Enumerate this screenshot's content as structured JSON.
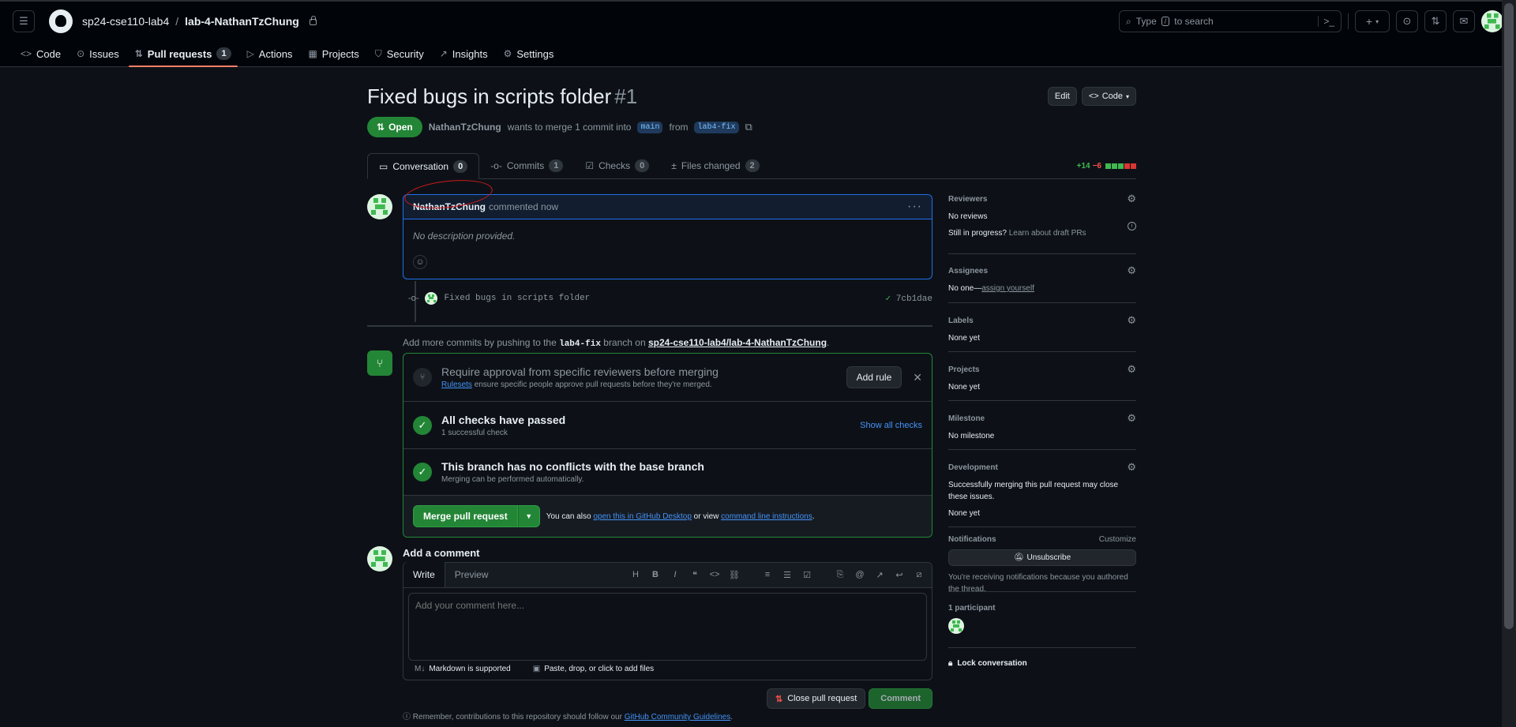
{
  "header": {
    "owner": "sp24-cse110-lab4",
    "repo": "lab-4-NathanTzChung",
    "search_prefix": "Type",
    "search_key": "/",
    "search_suffix": "to search"
  },
  "repo_nav": [
    {
      "icon": "<>",
      "label": "Code"
    },
    {
      "icon": "⊙",
      "label": "Issues"
    },
    {
      "icon": "⇅",
      "label": "Pull requests",
      "count": "1"
    },
    {
      "icon": "▷",
      "label": "Actions"
    },
    {
      "icon": "▦",
      "label": "Projects"
    },
    {
      "icon": "⛉",
      "label": "Security"
    },
    {
      "icon": "↗",
      "label": "Insights"
    },
    {
      "icon": "⚙",
      "label": "Settings"
    }
  ],
  "pr": {
    "title": "Fixed bugs in scripts folder",
    "number": "#1",
    "edit_label": "Edit",
    "code_label": "Code",
    "state": "Open",
    "author": "NathanTzChung",
    "merge_text_1": "wants to merge 1 commit into",
    "base_branch": "main",
    "merge_text_2": "from",
    "head_branch": "lab4-fix"
  },
  "tabs": [
    {
      "label": "Conversation",
      "count": "0",
      "icon": "▭"
    },
    {
      "label": "Commits",
      "count": "1",
      "icon": "-o-"
    },
    {
      "label": "Checks",
      "count": "0",
      "icon": "☑"
    },
    {
      "label": "Files changed",
      "count": "2",
      "icon": "±"
    }
  ],
  "diffstat": {
    "additions": "+14",
    "deletions": "−6"
  },
  "comment": {
    "author": "NathanTzChung",
    "when": "commented now",
    "body": "No description provided."
  },
  "timeline_commit": {
    "message": "Fixed bugs in scripts folder",
    "sha": "7cb1dae"
  },
  "push_note": {
    "prefix": "Add more commits by pushing to the",
    "branch": "lab4-fix",
    "mid": "branch on",
    "repo": "sp24-cse110-lab4/lab-4-NathanTzChung",
    "end": "."
  },
  "merge_box": {
    "rule_title": "Require approval from specific reviewers before merging",
    "rule_link": "Rulesets",
    "rule_sub": "ensure specific people approve pull requests before they're merged.",
    "add_rule": "Add rule",
    "checks_title": "All checks have passed",
    "checks_sub": "1 successful check",
    "show_checks": "Show all checks",
    "conflicts_title": "This branch has no conflicts with the base branch",
    "conflicts_sub": "Merging can be performed automatically.",
    "merge_button": "Merge pull request",
    "alt_prefix": "You can also",
    "alt_link1": "open this in GitHub Desktop",
    "alt_mid": "or view",
    "alt_link2": "command line instructions",
    "alt_end": "."
  },
  "add_comment": {
    "title": "Add a comment",
    "write_tab": "Write",
    "preview_tab": "Preview",
    "placeholder": "Add your comment here...",
    "markdown_note": "Markdown is supported",
    "files_note": "Paste, drop, or click to add files",
    "close_pr": "Close pull request",
    "comment_btn": "Comment",
    "footnote_prefix": "Remember, contributions to this repository should follow our",
    "footnote_link": "GitHub Community Guidelines",
    "footnote_end": "."
  },
  "sidebar": {
    "reviewers_label": "Reviewers",
    "reviewers_val": "No reviews",
    "draft_q": "Still in progress?",
    "draft_link": "Learn about draft PRs",
    "assignees_label": "Assignees",
    "assignees_val": "No one—",
    "assign_link": "assign yourself",
    "labels_label": "Labels",
    "labels_val": "None yet",
    "projects_label": "Projects",
    "projects_val": "None yet",
    "milestone_label": "Milestone",
    "milestone_val": "No milestone",
    "development_label": "Development",
    "development_text": "Successfully merging this pull request may close these issues.",
    "development_val": "None yet",
    "notifications_label": "Notifications",
    "customize": "Customize",
    "unsubscribe": "Unsubscribe",
    "notif_reason": "You're receiving notifications because you authored the thread.",
    "participants": "1 participant",
    "lock": "Lock conversation"
  },
  "colors": {
    "bg": "#0d1117",
    "accent_green": "#238636",
    "link_blue": "#4493f8",
    "annotation_red": "#d11a1a"
  }
}
